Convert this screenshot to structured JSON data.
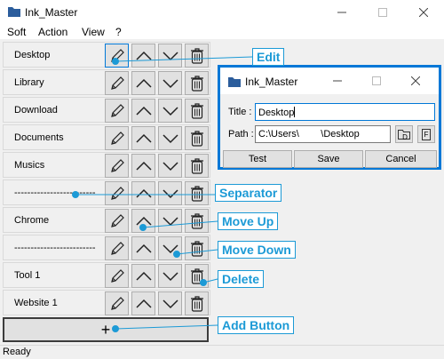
{
  "window": {
    "title": "Ink_Master",
    "status": "Ready"
  },
  "menu": [
    "Soft",
    "Action",
    "View",
    "?"
  ],
  "rows": [
    {
      "label": "Desktop"
    },
    {
      "label": "Library"
    },
    {
      "label": "Download"
    },
    {
      "label": "Documents"
    },
    {
      "label": "Musics"
    },
    {
      "label": "-------------------------"
    },
    {
      "label": "Chrome"
    },
    {
      "label": "-------------------------"
    },
    {
      "label": "Tool 1"
    },
    {
      "label": "Website 1"
    }
  ],
  "add_button": {
    "label": "+"
  },
  "dialog": {
    "title": "Ink_Master",
    "title_label": "Title :",
    "title_value": "Desktop",
    "path_label": "Path :",
    "path_value": "C:\\Users\\        \\Desktop",
    "folder_btn": "D",
    "file_btn": "F",
    "buttons": {
      "test": "Test",
      "save": "Save",
      "cancel": "Cancel"
    }
  },
  "annotations": {
    "edit": "Edit",
    "separator": "Separator",
    "move_up": "Move Up",
    "move_down": "Move Down",
    "delete": "Delete",
    "add_button": "Add Button"
  },
  "colors": {
    "accent": "#0078d7",
    "annotation": "#1c9ad6"
  }
}
